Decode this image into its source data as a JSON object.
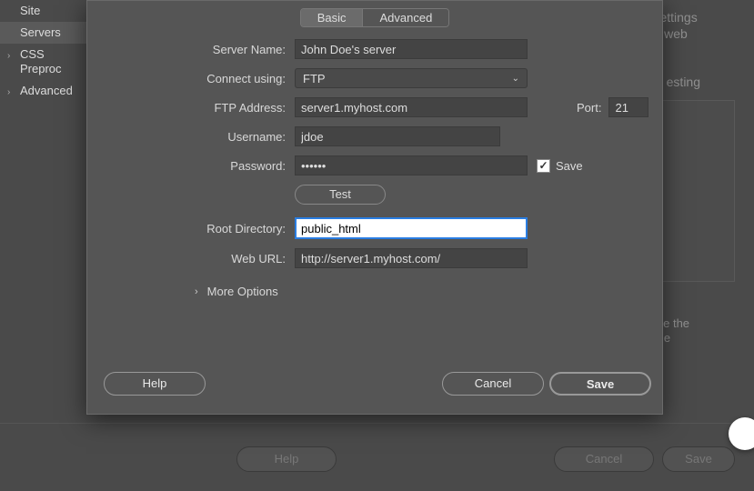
{
  "sidebar": {
    "items": [
      {
        "label": "Site",
        "expandable": false
      },
      {
        "label": "Servers",
        "expandable": false,
        "selected": true
      },
      {
        "label": "CSS Preproc",
        "expandable": true
      },
      {
        "label": "Advanced",
        "expandable": true
      }
    ]
  },
  "background": {
    "line1": "ne settings",
    "line2": "your web",
    "heading": "esting",
    "hint1": "ble the",
    "hint2": "the"
  },
  "bottom_buttons": {
    "help": "Help",
    "cancel": "Cancel",
    "save": "Save"
  },
  "modal": {
    "tabs": {
      "basic": "Basic",
      "advanced": "Advanced"
    },
    "labels": {
      "server_name": "Server Name:",
      "connect_using": "Connect using:",
      "ftp_address": "FTP Address:",
      "port": "Port:",
      "username": "Username:",
      "password": "Password:",
      "root_dir": "Root Directory:",
      "web_url": "Web URL:"
    },
    "values": {
      "server_name": "John Doe's server",
      "connect_using": "FTP",
      "ftp_address": "server1.myhost.com",
      "port": "21",
      "username": "jdoe",
      "password": "••••••",
      "root_dir": "public_html",
      "web_url": "http://server1.myhost.com/"
    },
    "save_checkbox_label": "Save",
    "test_button": "Test",
    "more_options": "More Options",
    "footer": {
      "help": "Help",
      "cancel": "Cancel",
      "save": "Save"
    }
  }
}
